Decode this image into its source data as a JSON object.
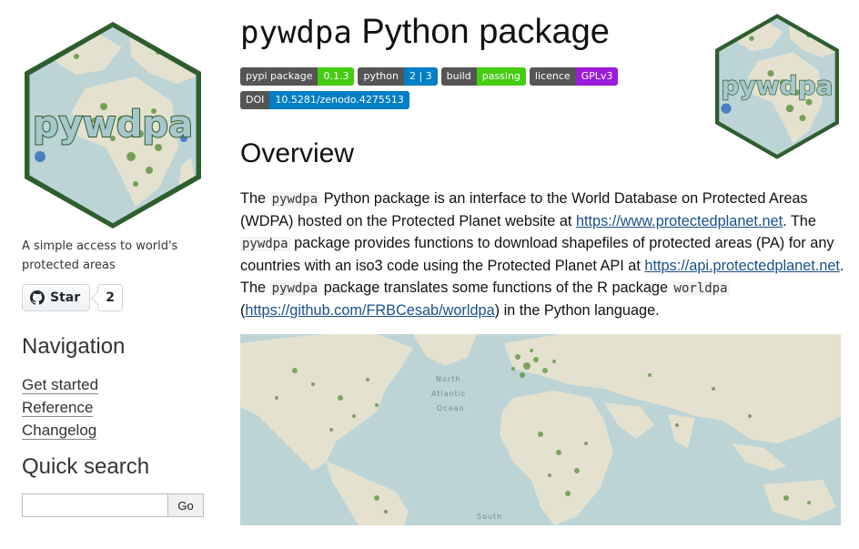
{
  "sidebar": {
    "logo_text": "pywdpa",
    "tagline": "A simple access to world's protected areas",
    "github": {
      "star_label": "Star",
      "count": "2"
    },
    "navigation_heading": "Navigation",
    "nav_items": [
      "Get started",
      "Reference",
      "Changelog"
    ],
    "quick_search_heading": "Quick search",
    "search_value": "",
    "search_button": "Go"
  },
  "header": {
    "title_pkg": "pywdpa",
    "title_rest": " Python package"
  },
  "badges": [
    {
      "label": "pypi package",
      "value": "0.1.3",
      "color": "#44cc11"
    },
    {
      "label": "python",
      "value": "2 | 3",
      "color": "#007ec6"
    },
    {
      "label": "build",
      "value": "passing",
      "color": "#44cc11"
    },
    {
      "label": "licence",
      "value": "GPLv3",
      "color": "#9b1bd9"
    },
    {
      "label": "DOI",
      "value": "10.5281/zenodo.4275513",
      "color": "#007ec6"
    }
  ],
  "overview": {
    "heading": "Overview",
    "p1": "The ",
    "c1": "pywdpa",
    "p2": " Python package is an interface to the World Database on Protected Areas (WDPA) hosted on the Protected Planet website at ",
    "link1": "https://www.protectedplanet.net",
    "p3": ". The ",
    "c2": "pywdpa",
    "p4": " package provides functions to download shapefiles of protected areas (PA) for any countries with an iso3 code using the Protected Planet API at ",
    "link2": "https://api.protectedplanet.net",
    "p5": ". The ",
    "c3": "pywdpa",
    "p6": " package translates some functions of the R package ",
    "c4": "worldpa",
    "p7": " (",
    "link3": "https://github.com/FRBCesab/worldpa",
    "p8": ") in the Python language."
  },
  "map": {
    "labels": [
      "North",
      "Atlantic",
      "Ocean",
      "South"
    ]
  },
  "colors": {
    "accent_link": "#1a4f8a",
    "logo_border": "#2e5e2e",
    "ocean": "#bcd4d6",
    "land": "#e4e2cf",
    "protected": "#5b8f3a"
  }
}
